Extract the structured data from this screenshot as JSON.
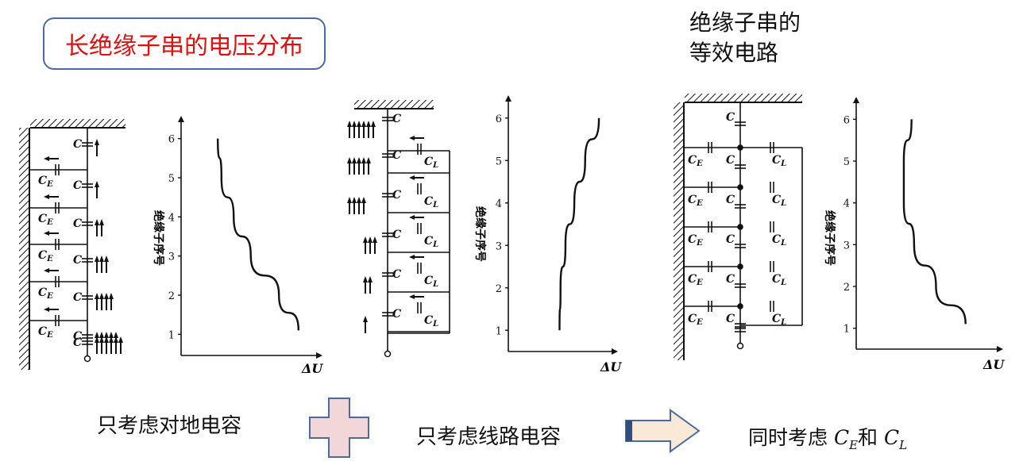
{
  "title": "长绝缘子串的电压分布",
  "equivalent_title": [
    "绝缘子串的",
    "等效电路"
  ],
  "captions": {
    "ground_only": "只考虑对地电容",
    "line_only": "只考虑线路电容",
    "both_prefix": "同时考虑 ",
    "ce": "C",
    "ce_sub": "E",
    "and": "和 ",
    "cl": "C",
    "cl_sub": "L"
  },
  "labels": {
    "C": "C",
    "CE": "C",
    "CE_sub": "E",
    "CL": "C",
    "CL_sub": "L",
    "ylabel": "绝缘子序号",
    "xlabel": "ΔU"
  },
  "chart_data": [
    {
      "type": "line",
      "panel": "ground capacitance only",
      "xlabel": "ΔU",
      "ylabel": "绝缘子序号",
      "yticks": [
        1,
        2,
        3,
        4,
        5,
        6
      ],
      "ylim": [
        0.5,
        6.5
      ],
      "points": [
        [
          0.3,
          6.0
        ],
        [
          0.33,
          5.0
        ],
        [
          0.43,
          4.0
        ],
        [
          0.57,
          3.0
        ],
        [
          0.8,
          2.0
        ],
        [
          0.96,
          1.1
        ]
      ]
    },
    {
      "type": "line",
      "panel": "line capacitance only",
      "xlabel": "ΔU",
      "ylabel": "绝缘子序号",
      "yticks": [
        1,
        2,
        3,
        4,
        5,
        6
      ],
      "ylim": [
        0.5,
        6.5
      ],
      "points": [
        [
          0.52,
          1.0
        ],
        [
          0.53,
          2.0
        ],
        [
          0.58,
          3.0
        ],
        [
          0.67,
          4.0
        ],
        [
          0.78,
          5.0
        ],
        [
          0.92,
          6.0
        ]
      ]
    },
    {
      "type": "line",
      "panel": "both CE and CL",
      "xlabel": "ΔU",
      "ylabel": "绝缘子序号",
      "yticks": [
        1,
        2,
        3,
        4,
        5,
        6
      ],
      "ylim": [
        0.5,
        6.5
      ],
      "points": [
        [
          0.43,
          6.0
        ],
        [
          0.37,
          5.0
        ],
        [
          0.37,
          4.0
        ],
        [
          0.45,
          3.0
        ],
        [
          0.62,
          2.0
        ],
        [
          0.85,
          1.1
        ]
      ]
    }
  ]
}
